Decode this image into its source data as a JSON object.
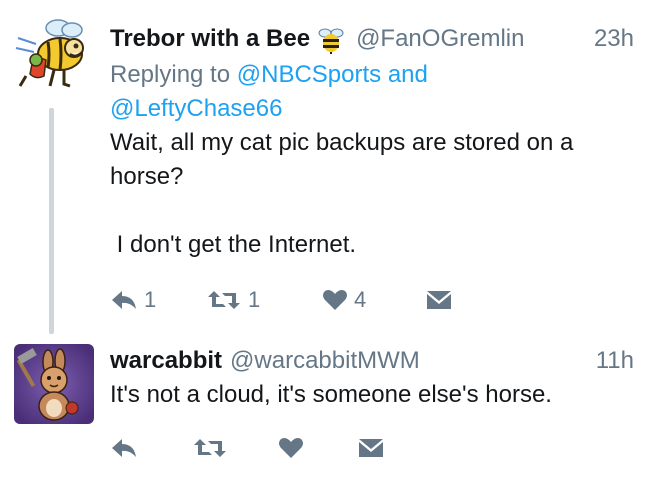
{
  "tweets": [
    {
      "display_name": "Trebor with a Bee",
      "name_emoji": "bee-icon",
      "handle": "@FanOGremlin",
      "timestamp": "23h",
      "replying_prefix": "Replying to ",
      "replying_to_1": "@NBCSports",
      "replying_joiner": " and",
      "replying_to_2": "@LeftyChase66",
      "text": "Wait, all my cat pic backups are stored on a horse?\n\n I don't get the Internet.",
      "actions": {
        "reply_count": "1",
        "retweet_count": "1",
        "like_count": "4"
      }
    },
    {
      "display_name": "warcabbit",
      "handle": "@warcabbitMWM",
      "timestamp": "11h",
      "text": "It's not a cloud, it's someone else's horse.",
      "actions": {
        "reply_count": "",
        "retweet_count": "",
        "like_count": ""
      }
    }
  ],
  "colors": {
    "text": "#14171a",
    "secondary": "#657786",
    "link": "#1da1f2",
    "thread_line": "#cdd6dd"
  },
  "icons": [
    "reply-icon",
    "retweet-icon",
    "like-icon",
    "direct-message-icon",
    "bee-icon"
  ]
}
